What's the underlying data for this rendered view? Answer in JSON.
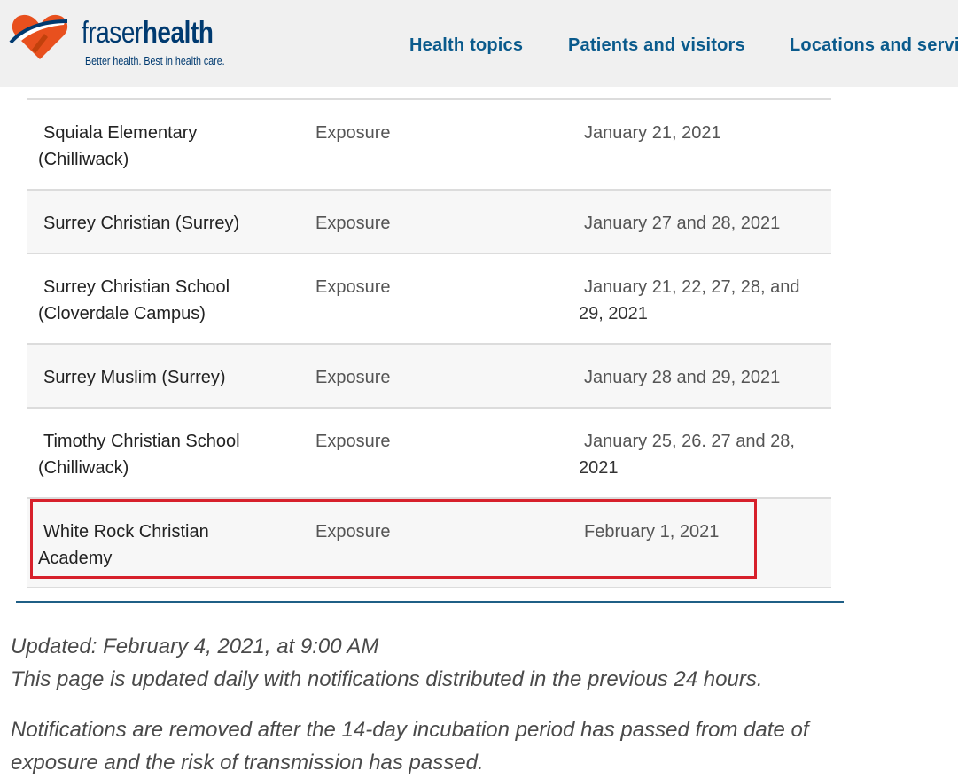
{
  "header": {
    "logo_word_1": "fraser",
    "logo_word_2": "health",
    "tagline": "Better health. Best in health care.",
    "nav": [
      "Health topics",
      "Patients and visitors",
      "Locations and servic"
    ]
  },
  "table": {
    "rows": [
      {
        "school_line1": "Squiala Elementary",
        "school_line2": "(Chilliwack)",
        "type": "Exposure",
        "dates_line1": "January 21,  2021",
        "dates_line2": ""
      },
      {
        "school_line1": "Surrey Christian (Surrey)",
        "school_line2": "",
        "type": "Exposure",
        "dates_line1": "January 27 and 28, 2021",
        "dates_line2": ""
      },
      {
        "school_line1": "Surrey Christian School",
        "school_line2": "(Cloverdale Campus)",
        "type": "Exposure",
        "dates_line1": "January 21, 22, 27, 28, and",
        "dates_line2": "29, 2021"
      },
      {
        "school_line1": "Surrey Muslim (Surrey)",
        "school_line2": "",
        "type": "Exposure",
        "dates_line1": "January 28 and 29,  2021",
        "dates_line2": ""
      },
      {
        "school_line1": "Timothy Christian School",
        "school_line2": "(Chilliwack)",
        "type": "Exposure",
        "dates_line1": "January 25, 26. 27 and 28,",
        "dates_line2": "2021"
      },
      {
        "school_line1": "White Rock Christian",
        "school_line2": "Academy",
        "type": "Exposure",
        "dates_line1": "February 1, 2021",
        "dates_line2": ""
      }
    ]
  },
  "notes": {
    "updated": "Updated: February 4, 2021, at 9:00 AM",
    "daily": "This page is updated daily with notifications distributed in the previous 24 hours.",
    "removed_line1": "Notifications are removed after the 14-day incubation period has passed from date of",
    "removed_line2": "exposure and the risk of transmission has passed."
  },
  "colors": {
    "brand_navy": "#003a70",
    "brand_orange": "#e8501e",
    "nav_blue": "#0a5a8c",
    "highlight_red": "#d7202b"
  }
}
